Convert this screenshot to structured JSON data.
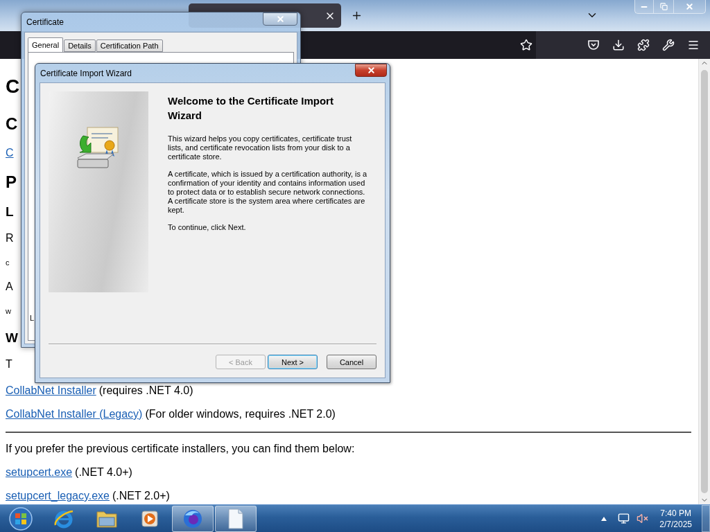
{
  "page": {
    "fragments": [
      {
        "kind": "h1",
        "text": "C"
      },
      {
        "kind": "h2",
        "text": "C"
      },
      {
        "kind": "link",
        "text": "C"
      },
      {
        "kind": "h2",
        "text": "P"
      },
      {
        "kind": "h3",
        "text": "L"
      },
      {
        "kind": "p",
        "text": "R"
      },
      {
        "kind": "small",
        "text": "c"
      },
      {
        "kind": "p",
        "text": "A"
      },
      {
        "kind": "small",
        "text": "w"
      },
      {
        "kind": "h3",
        "text": "W"
      },
      {
        "kind": "p",
        "text": "T"
      }
    ],
    "downloads": [
      {
        "link": "CollabNet Installer",
        "note": "(requires .NET 4.0)"
      },
      {
        "link": "CollabNet Installer (Legacy)",
        "note": "(For older windows, requires .NET 2.0)"
      }
    ],
    "intro": "If you prefer the previous certificate installers, you can find them below:",
    "files": [
      {
        "link": "setupcert.exe",
        "note": "(.NET 4.0+)"
      },
      {
        "link": "setupcert_legacy.exe",
        "note": "(.NET 2.0+)"
      }
    ]
  },
  "certificate_window": {
    "title": "Certificate",
    "tabs": [
      {
        "label": "General",
        "selected": true
      },
      {
        "label": "Details",
        "selected": false
      },
      {
        "label": "Certification Path",
        "selected": false
      }
    ],
    "panel_text": "L"
  },
  "wizard": {
    "title": "Certificate Import Wizard",
    "heading": "Welcome to the Certificate Import Wizard",
    "paragraphs": [
      "This wizard helps you copy certificates, certificate trust lists, and certificate revocation lists from your disk to a certificate store.",
      "A certificate, which is issued by a certification authority, is a confirmation of your identity and contains information used to protect data or to establish secure network connections. A certificate store is the system area where certificates are kept.",
      "To continue, click Next."
    ],
    "buttons": [
      {
        "label": "< Back",
        "disabled": true,
        "default": false
      },
      {
        "label": "Next >",
        "disabled": false,
        "default": true
      },
      {
        "label": "Cancel",
        "disabled": false,
        "default": false
      }
    ]
  },
  "taskbar": {
    "apps": [
      {
        "kind": "ie",
        "running": false
      },
      {
        "kind": "explorer",
        "running": false
      },
      {
        "kind": "media",
        "running": false
      },
      {
        "kind": "firefox",
        "running": true
      },
      {
        "kind": "document",
        "running": true
      }
    ],
    "clock": {
      "time": "7:40 PM",
      "date": "2/7/2025"
    }
  }
}
